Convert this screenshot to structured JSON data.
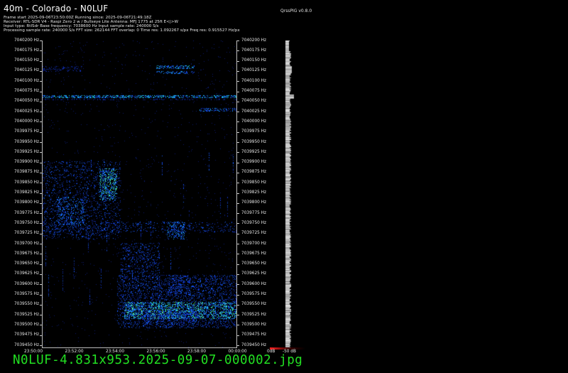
{
  "header": {
    "title": "40m - Colorado - N0LUF",
    "version": "QrssPIG v0.8.0",
    "info_lines": [
      "Frame start 2025-09-06T23:50:00Z Running since: 2025-09-06T21:49:18Z",
      "Receiver: RTL-SDR V4 - Raspi Zero 2 w / Bullseye Lite Antenna: MFJ 1775 at 25ft E<|>W",
      "Input type: RtlSdr Base frequency: 7038600 Hz Input sample rate: 240000 S/s",
      "Processing sample rate: 240000 S/s FFT size: 262144 FFT overlap: 0 Time res: 1.092267 s/px Freq res: 0.915527 Hz/px"
    ]
  },
  "y_axis": {
    "labels": [
      "7040200 Hz",
      "7040175 Hz",
      "7040150 Hz",
      "7040125 Hz",
      "7040100 Hz",
      "7040075 Hz",
      "7040050 Hz",
      "7040025 Hz",
      "7040000 Hz",
      "7039975 Hz",
      "7039950 Hz",
      "7039925 Hz",
      "7039900 Hz",
      "7039875 Hz",
      "7039850 Hz",
      "7039825 Hz",
      "7039800 Hz",
      "7039775 Hz",
      "7039750 Hz",
      "7039725 Hz",
      "7039700 Hz",
      "7039675 Hz",
      "7039650 Hz",
      "7039625 Hz",
      "7039600 Hz",
      "7039575 Hz",
      "7039550 Hz",
      "7039525 Hz",
      "7039500 Hz",
      "7039475 Hz",
      "7039450 Hz"
    ]
  },
  "x_axis": {
    "labels": [
      "23:50:00",
      "23:52:00",
      "23:54:00",
      "23:56:00",
      "23:58:00",
      "00:00:00"
    ]
  },
  "scale": {
    "min_label": "0dB",
    "max_label": "-50 dB"
  },
  "footer": {
    "filename": "N0LUF-4.831x953.2025-09-07-000002.jpg"
  }
}
